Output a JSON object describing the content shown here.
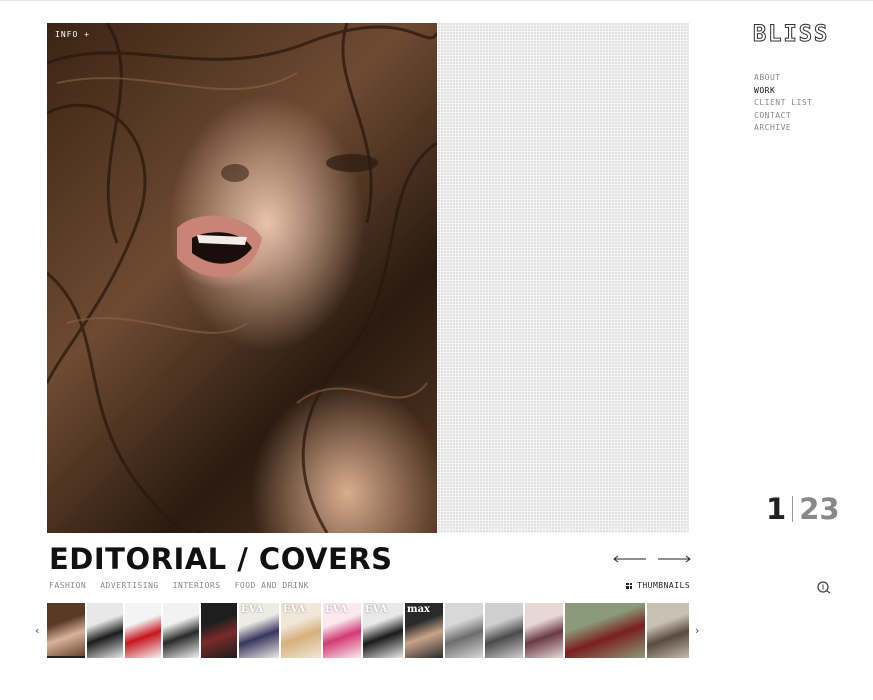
{
  "brand": {
    "logo": "BLISS"
  },
  "nav": {
    "items": [
      {
        "label": "ABOUT",
        "active": false
      },
      {
        "label": "WORK",
        "active": true
      },
      {
        "label": "CLIENT LIST",
        "active": false
      },
      {
        "label": "CONTACT",
        "active": false
      },
      {
        "label": "ARCHIVE",
        "active": false
      }
    ]
  },
  "photo": {
    "info_label": "INFO +"
  },
  "counter": {
    "current": "1",
    "total": "23"
  },
  "gallery": {
    "title": "EDITORIAL / COVERS",
    "categories": [
      "FASHION",
      "ADVERTISING",
      "INTERIORS",
      "FOOD AND DRINK"
    ],
    "thumbnails_label": "THUMBNAILS",
    "prev_icon": "arrow-left-icon",
    "next_icon": "arrow-right-icon",
    "zoom_icon": "zoom-icon"
  },
  "filmstrip": {
    "prev_label": "‹",
    "next_label": "›",
    "thumbs": [
      {
        "caption": "",
        "colors": [
          "#5a3a25",
          "#d9b29a"
        ],
        "active": true
      },
      {
        "caption": "",
        "colors": [
          "#e8e8e8",
          "#1c1c1c"
        ],
        "active": false
      },
      {
        "caption": "",
        "colors": [
          "#f4f4f4",
          "#c8161d"
        ],
        "active": false
      },
      {
        "caption": "",
        "colors": [
          "#f2f2f2",
          "#2a2a2a"
        ],
        "active": false
      },
      {
        "caption": "",
        "colors": [
          "#1e1e1e",
          "#7a2a2a"
        ],
        "active": false
      },
      {
        "caption": "EVA",
        "colors": [
          "#ecebe6",
          "#3a3560"
        ],
        "active": false
      },
      {
        "caption": "EVA",
        "colors": [
          "#f1e7d9",
          "#d7b07a"
        ],
        "active": false
      },
      {
        "caption": "EVA",
        "colors": [
          "#fbe9ee",
          "#d23a74"
        ],
        "active": false
      },
      {
        "caption": "EVA",
        "colors": [
          "#e9e9e9",
          "#1a1a1a"
        ],
        "active": false
      },
      {
        "caption": "max",
        "colors": [
          "#2a2a2a",
          "#c9a38a"
        ],
        "active": false
      },
      {
        "caption": "",
        "colors": [
          "#d8d8d8",
          "#6d6d6d"
        ],
        "active": false
      },
      {
        "caption": "",
        "colors": [
          "#cfcfcf",
          "#4a4a4a"
        ],
        "active": false
      },
      {
        "caption": "",
        "colors": [
          "#e7d7d5",
          "#6a3a45"
        ],
        "active": false
      },
      {
        "caption": "",
        "colors": [
          "#8a9a7a",
          "#7a1f1f"
        ],
        "active": false
      },
      {
        "caption": "",
        "colors": [
          "#c9c1b4",
          "#5a4a40"
        ],
        "active": false
      }
    ]
  },
  "colors": {
    "accent": "#222222",
    "muted": "#888888"
  }
}
